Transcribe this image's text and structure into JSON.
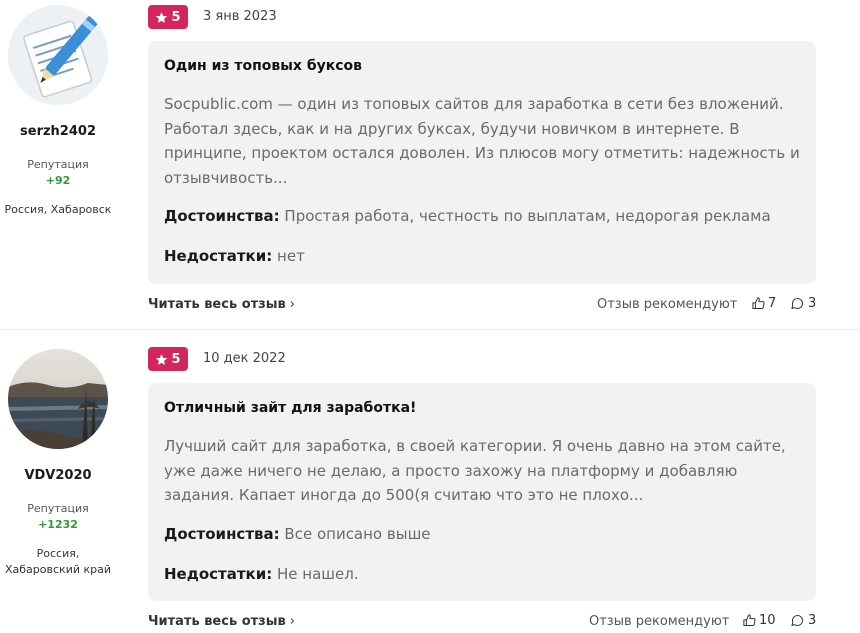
{
  "reviews": [
    {
      "author": {
        "name": "serzh2402",
        "avatar_icon": "pen-and-notepad-icon",
        "reputation_label": "Репутация",
        "reputation_value": "+92",
        "location": "Россия, Хабаровск"
      },
      "rating": "5",
      "date": "3 янв 2023",
      "title": "Один из топовых буксов",
      "body": "Socpublic.com — один из топовых сайтов для заработка в сети без вложений. Работал здесь, как и на других буксах, будучи новичком в интернете. В принципе, проектом остался доволен. Из плюсов могу отметить: надежность и отзывчивость...",
      "pros_label": "Достоинства:",
      "pros": "Простая работа, честность по выплатам, недорогая реклама",
      "cons_label": "Недостатки:",
      "cons": "нет",
      "read_more": "Читать весь отзыв",
      "recommend_label": "Отзыв рекомендуют",
      "likes": "7",
      "comments": "3"
    },
    {
      "author": {
        "name": "VDV2020",
        "avatar_icon": "landscape-photo-avatar",
        "reputation_label": "Репутация",
        "reputation_value": "+1232",
        "location": "Россия, Хабаровский край"
      },
      "rating": "5",
      "date": "10 дек 2022",
      "title": "Отличный зайт для заработка!",
      "body": "Лучший сайт для заработка, в своей категории. Я очень давно на этом сайте, уже даже ничего не делаю, а просто захожу на платформу и добавляю задания. Капает иногда до 500(я считаю что это не плохо...",
      "pros_label": "Достоинства:",
      "pros": "Все описано выше",
      "cons_label": "Недостатки:",
      "cons": "Не нашел.",
      "read_more": "Читать весь отзыв",
      "recommend_label": "Отзыв рекомендуют",
      "likes": "10",
      "comments": "3"
    }
  ],
  "colors": {
    "rating_badge": "#d4265c",
    "reputation": "#2a9d38",
    "card_bg": "#f2f2f2"
  }
}
